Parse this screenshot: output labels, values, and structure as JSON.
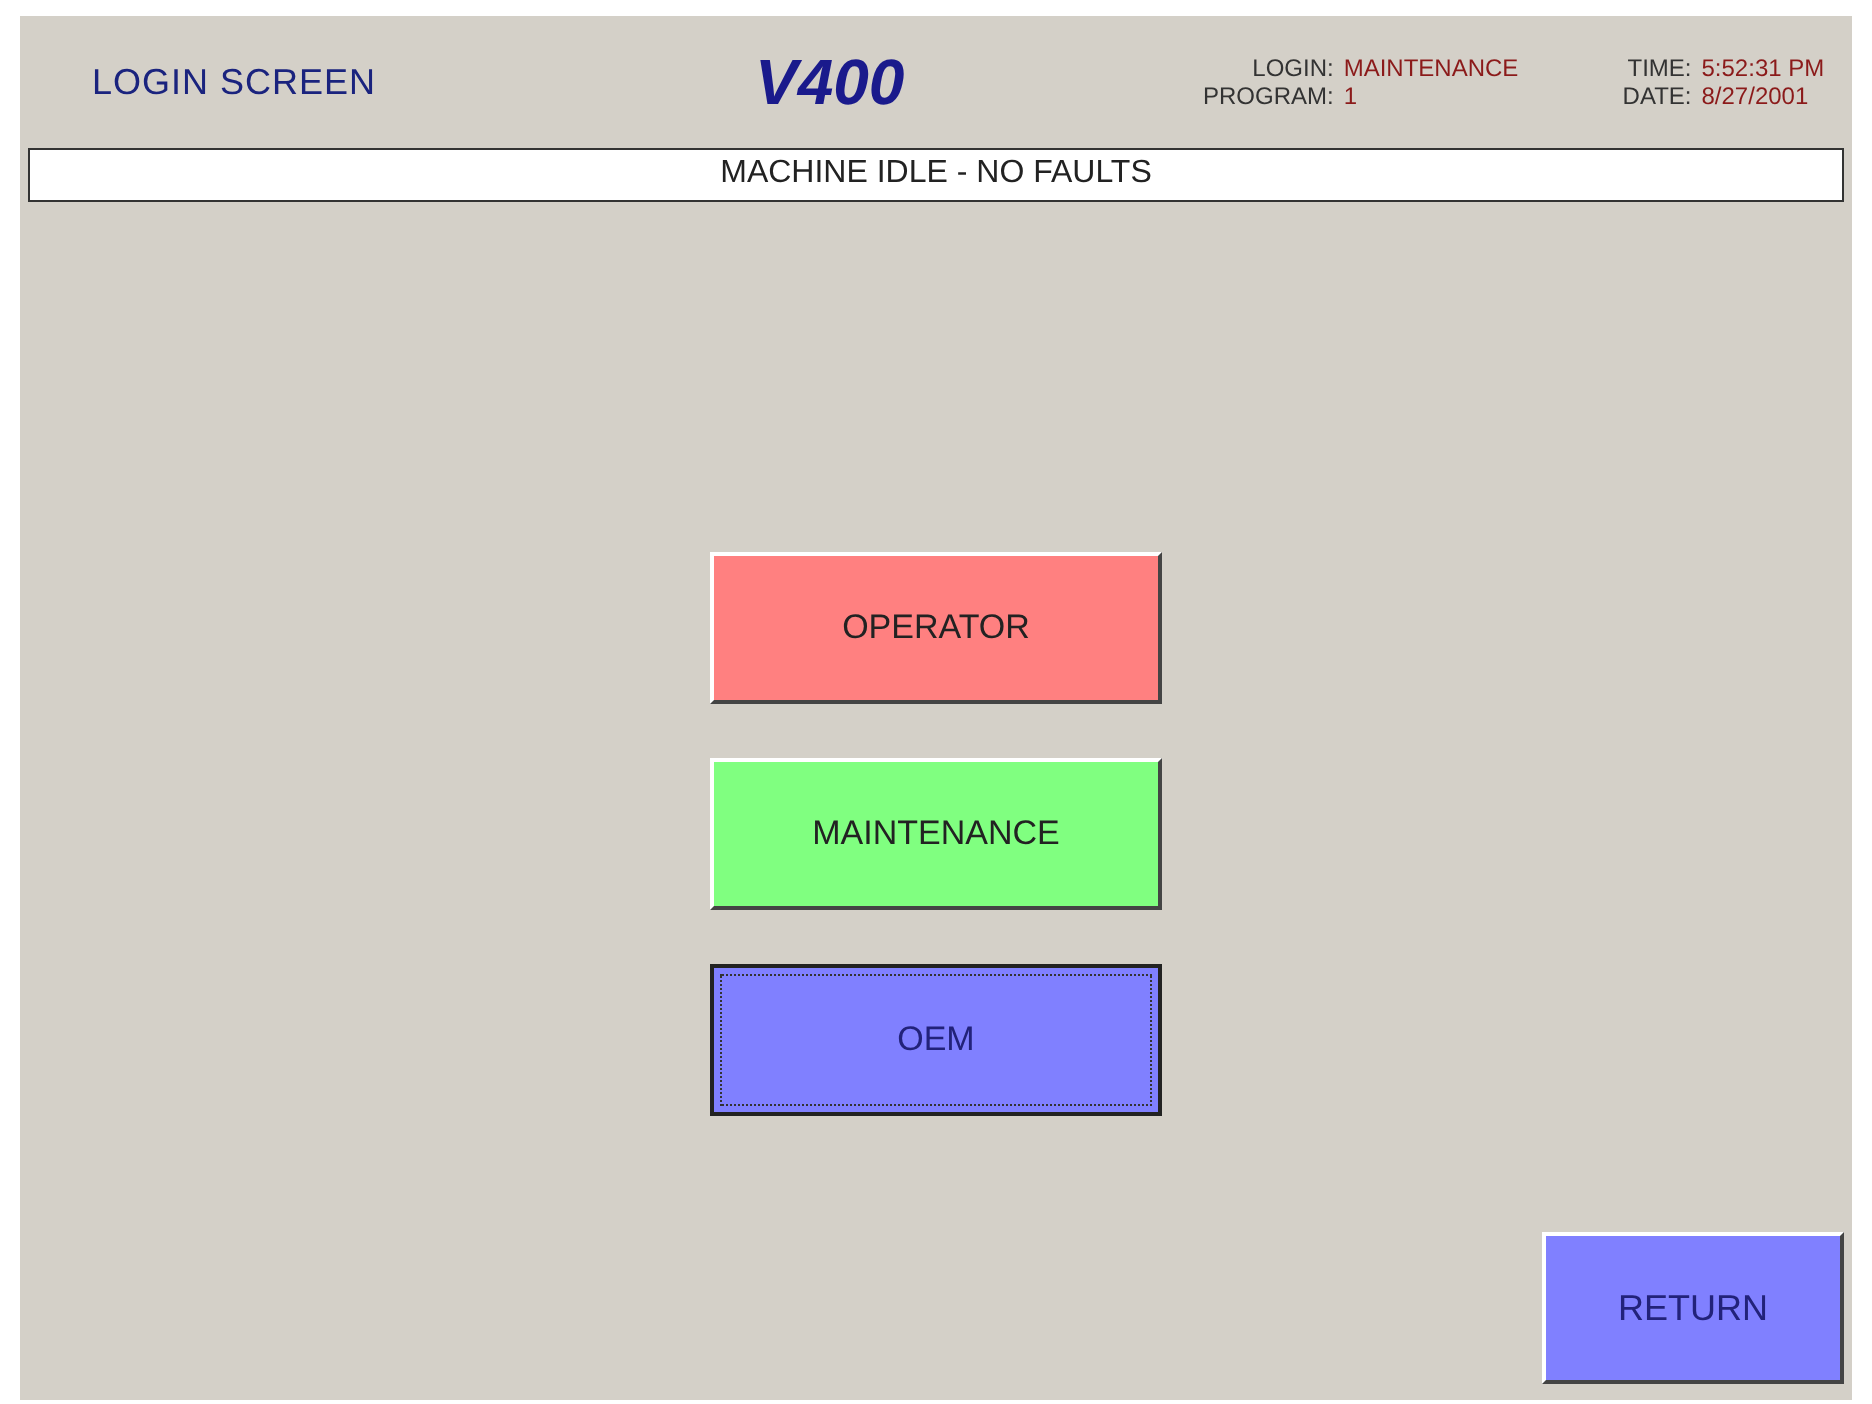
{
  "header": {
    "title": "LOGIN SCREEN",
    "logo": "V400",
    "login_label": "LOGIN:",
    "login_value": "MAINTENANCE",
    "program_label": "PROGRAM:",
    "program_value": "1",
    "time_label": "TIME:",
    "time_value": "5:52:31 PM",
    "date_label": "DATE:",
    "date_value": "8/27/2001"
  },
  "status_bar": "MACHINE IDLE - NO FAULTS",
  "login_buttons": [
    {
      "label": "OPERATOR",
      "color": "#ff8080",
      "focused": false
    },
    {
      "label": "MAINTENANCE",
      "color": "#80ff80",
      "focused": false
    },
    {
      "label": "OEM",
      "color": "#8080ff",
      "focused": true
    }
  ],
  "return_button": {
    "label": "RETURN",
    "color": "#8080ff"
  }
}
